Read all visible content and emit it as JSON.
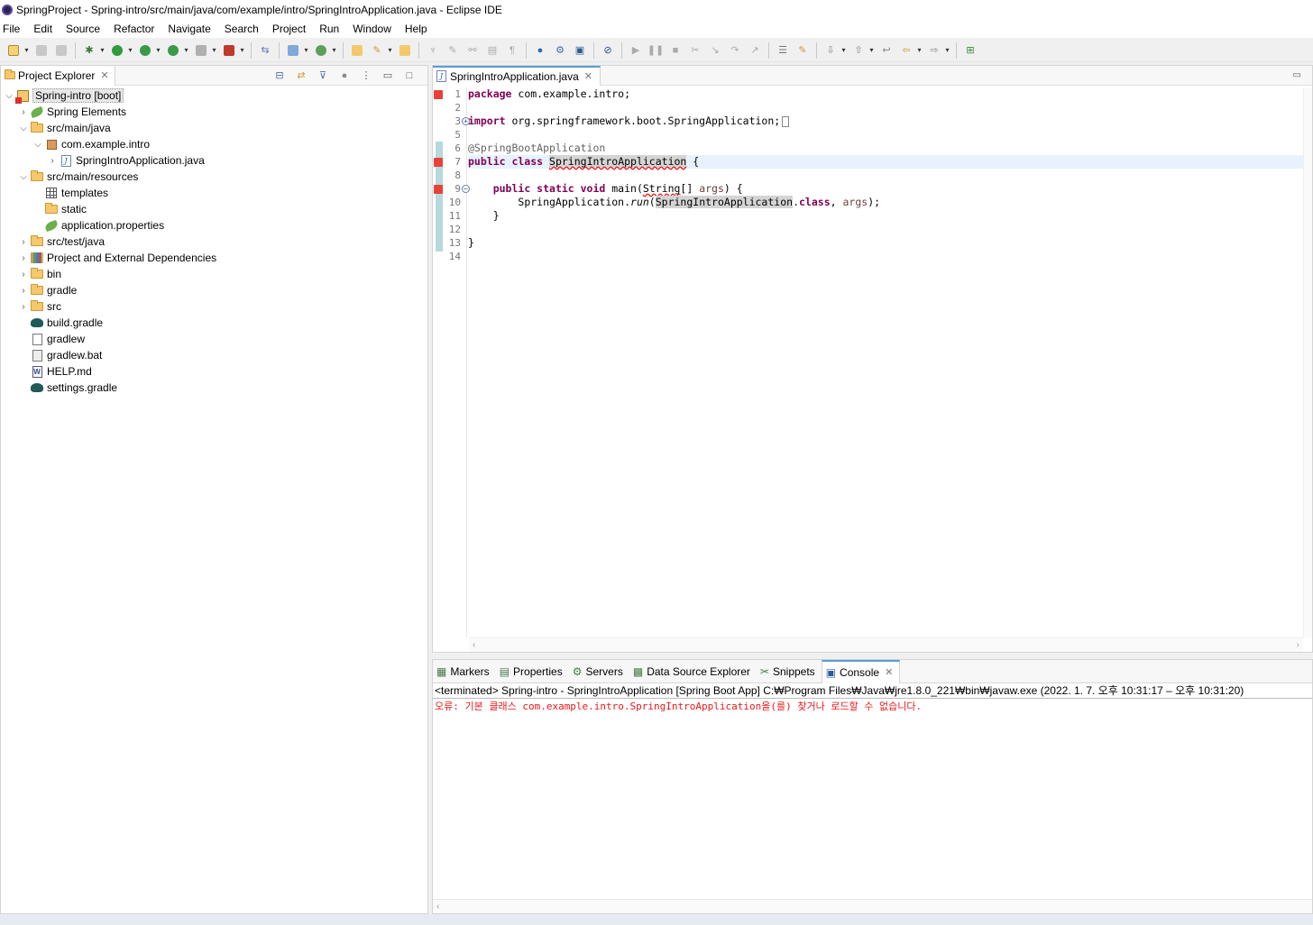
{
  "window": {
    "title": "SpringProject - Spring-intro/src/main/java/com/example/intro/SpringIntroApplication.java - Eclipse IDE"
  },
  "menu": [
    "File",
    "Edit",
    "Source",
    "Refactor",
    "Navigate",
    "Search",
    "Project",
    "Run",
    "Window",
    "Help"
  ],
  "project_explorer": {
    "tab_label": "Project Explorer",
    "tree": [
      {
        "label": "Spring-intro [boot]",
        "depth": 0,
        "twisty": "open",
        "icon": "project-error-icon"
      },
      {
        "label": "Spring Elements",
        "depth": 1,
        "twisty": "closed",
        "icon": "spring-leaf-icon"
      },
      {
        "label": "src/main/java",
        "depth": 1,
        "twisty": "open",
        "icon": "source-folder-icon"
      },
      {
        "label": "com.example.intro",
        "depth": 2,
        "twisty": "open",
        "icon": "package-icon"
      },
      {
        "label": "SpringIntroApplication.java",
        "depth": 3,
        "twisty": "closed",
        "icon": "java-file-icon"
      },
      {
        "label": "src/main/resources",
        "depth": 1,
        "twisty": "open",
        "icon": "source-folder-icon"
      },
      {
        "label": "templates",
        "depth": 2,
        "twisty": "none",
        "icon": "templates-grid-icon"
      },
      {
        "label": "static",
        "depth": 2,
        "twisty": "none",
        "icon": "folder-icon"
      },
      {
        "label": "application.properties",
        "depth": 2,
        "twisty": "none",
        "icon": "spring-leaf-icon"
      },
      {
        "label": "src/test/java",
        "depth": 1,
        "twisty": "closed",
        "icon": "source-folder-icon"
      },
      {
        "label": "Project and External Dependencies",
        "depth": 1,
        "twisty": "closed",
        "icon": "library-icon"
      },
      {
        "label": "bin",
        "depth": 1,
        "twisty": "closed",
        "icon": "folder-icon"
      },
      {
        "label": "gradle",
        "depth": 1,
        "twisty": "closed",
        "icon": "folder-icon"
      },
      {
        "label": "src",
        "depth": 1,
        "twisty": "closed",
        "icon": "folder-icon"
      },
      {
        "label": "build.gradle",
        "depth": 1,
        "twisty": "none",
        "icon": "gradle-icon"
      },
      {
        "label": "gradlew",
        "depth": 1,
        "twisty": "none",
        "icon": "text-file-icon"
      },
      {
        "label": "gradlew.bat",
        "depth": 1,
        "twisty": "none",
        "icon": "bat-file-icon"
      },
      {
        "label": "HELP.md",
        "depth": 1,
        "twisty": "none",
        "icon": "markdown-file-icon"
      },
      {
        "label": "settings.gradle",
        "depth": 1,
        "twisty": "none",
        "icon": "gradle-icon"
      }
    ]
  },
  "editor": {
    "tab_label": "SpringIntroApplication.java",
    "line_numbers": [
      "1",
      "2",
      "3",
      "5",
      "6",
      "7",
      "8",
      "9",
      "10",
      "11",
      "12",
      "13",
      "14"
    ],
    "code": {
      "l1_kw": "package",
      "l1_rest": " com.example.intro;",
      "l3_kw": "import",
      "l3_rest": " org.springframework.boot.SpringApplication;",
      "l6_ann": "@SpringBootApplication",
      "l7_kw": "public class",
      "l7_class": "SpringIntroApplication",
      "l7_rest": " {",
      "l9_kw": "public static void",
      "l9_main": " main(",
      "l9_type": "String",
      "l9_arr": "[] ",
      "l9_param": "args",
      "l9_rest": ") {",
      "l10_obj": "SpringApplication.",
      "l10_method": "run",
      "l10_open": "(",
      "l10_class": "SpringIntroApplication",
      "l10_dot": ".",
      "l10_kw": "class",
      "l10_comma": ", ",
      "l10_param": "args",
      "l10_end": ");",
      "l11": "    }",
      "l13": "}"
    }
  },
  "bottom_views": {
    "tabs": [
      {
        "label": "Markers",
        "icon": "markers-icon"
      },
      {
        "label": "Properties",
        "icon": "properties-icon"
      },
      {
        "label": "Servers",
        "icon": "servers-icon"
      },
      {
        "label": "Data Source Explorer",
        "icon": "data-source-icon"
      },
      {
        "label": "Snippets",
        "icon": "snippets-icon"
      },
      {
        "label": "Console",
        "icon": "console-icon",
        "active": true
      }
    ],
    "console_status": "<terminated> Spring-intro - SpringIntroApplication [Spring Boot App] C:₩Program Files₩Java₩jre1.8.0_221₩bin₩javaw.exe  (2022. 1. 7. 오후 10:31:17 – 오후 10:31:20)",
    "console_error": "오류: 기본 클래스 com.example.intro.SpringIntroApplication을(를) 찾거나 로드할 수 없습니다."
  },
  "colors": {
    "keyword": "#7f0055",
    "error_text": "#e8191a",
    "annotation": "#646464"
  }
}
